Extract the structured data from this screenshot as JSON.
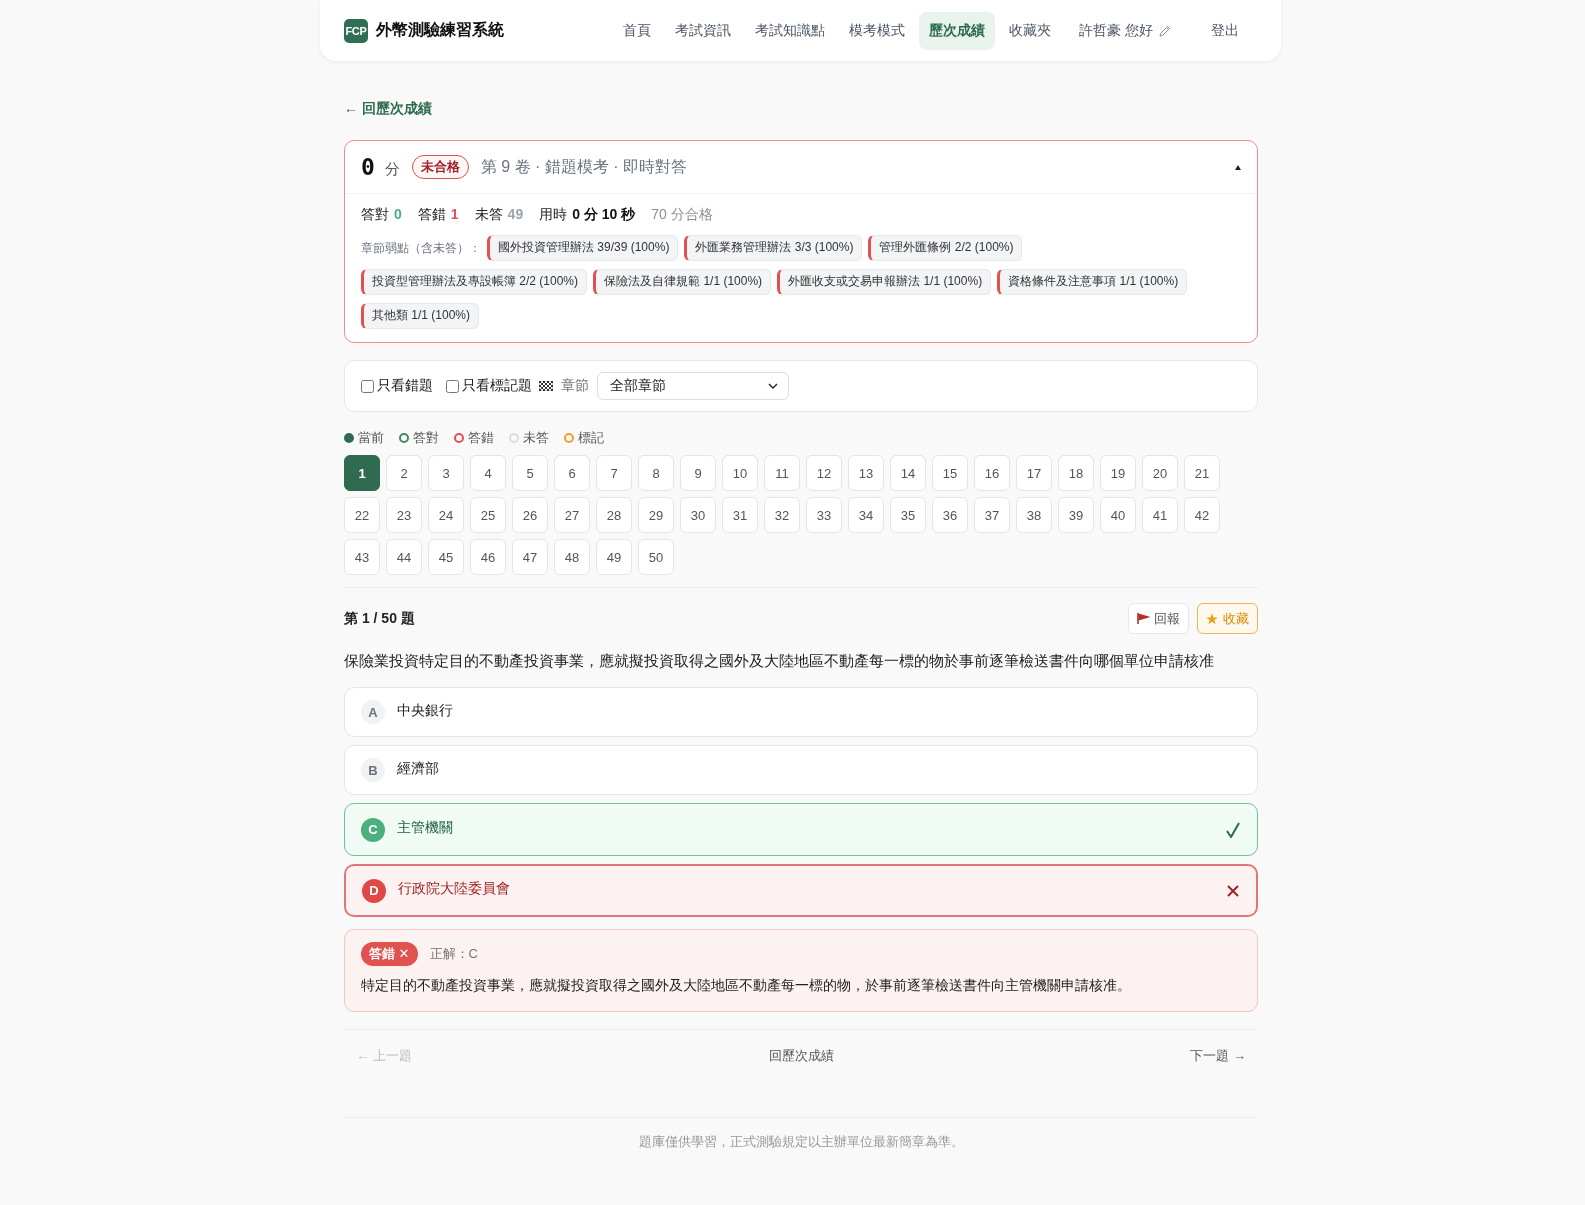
{
  "header": {
    "logo_text": "FCP",
    "title": "外幣測驗練習系統",
    "nav": [
      {
        "label": "首頁",
        "selected": false
      },
      {
        "label": "考試資訊",
        "selected": false
      },
      {
        "label": "考試知識點",
        "selected": false
      },
      {
        "label": "模考模式",
        "selected": false
      },
      {
        "label": "歷次成績",
        "selected": true
      },
      {
        "label": "收藏夾",
        "selected": false
      }
    ],
    "greeting": "許哲豪 您好",
    "logout": "登出"
  },
  "back_link": "← 回歷次成績",
  "score_card": {
    "score": "0",
    "unit": "分",
    "passed": false,
    "badge": "未合格",
    "title": "第 9 卷 · 錯題模考 · 即時對答",
    "expanded": true,
    "stats": [
      {
        "label": "答對",
        "value": "0",
        "kind": "correct"
      },
      {
        "label": "答錯",
        "value": "1",
        "kind": "wrong"
      },
      {
        "label": "未答",
        "value": "49",
        "kind": "unanswered"
      },
      {
        "label": "用時",
        "value": "0 分 10 秒",
        "kind": "time"
      }
    ],
    "pass_mark": "70 分合格",
    "weak_label": "章節弱點（含未答）：",
    "weak_tags": [
      "國外投資管理辦法 39/39 (100%)",
      "外匯業務管理辦法 3/3 (100%)",
      "管理外匯條例 2/2 (100%)",
      "投資型管理辦法及專設帳簿 2/2 (100%)",
      "保險法及自律規範 1/1 (100%)",
      "外匯收支或交易申報辦法 1/1 (100%)",
      "資格條件及注意事項 1/1 (100%)",
      "其他類 1/1 (100%)"
    ]
  },
  "filters": {
    "checkboxes": [
      {
        "label": "只看錯題",
        "checked": false,
        "kind": "plain"
      },
      {
        "label": "只看標記題",
        "checked": false,
        "kind": "flagged"
      }
    ],
    "chapter_label": "章節",
    "chapter_value": "全部章節"
  },
  "legend": [
    {
      "label": "當前",
      "color": "#2e6b50",
      "kind": "filled"
    },
    {
      "label": "答對",
      "color": "#3f8a64",
      "kind": "ring"
    },
    {
      "label": "答錯",
      "color": "#e05252",
      "kind": "ring"
    },
    {
      "label": "未答",
      "color": "#dddddd",
      "kind": "ring"
    },
    {
      "label": "標記",
      "color": "#f0a030",
      "kind": "ring"
    }
  ],
  "question_grid": [
    {
      "number": "1",
      "selected": true
    },
    {
      "number": "2",
      "selected": false
    },
    {
      "number": "3",
      "selected": false
    },
    {
      "number": "4",
      "selected": false
    },
    {
      "number": "5",
      "selected": false
    },
    {
      "number": "6",
      "selected": false
    },
    {
      "number": "7",
      "selected": false
    },
    {
      "number": "8",
      "selected": false
    },
    {
      "number": "9",
      "selected": false
    },
    {
      "number": "10",
      "selected": false
    },
    {
      "number": "11",
      "selected": false
    },
    {
      "number": "12",
      "selected": false
    },
    {
      "number": "13",
      "selected": false
    },
    {
      "number": "14",
      "selected": false
    },
    {
      "number": "15",
      "selected": false
    },
    {
      "number": "16",
      "selected": false
    },
    {
      "number": "17",
      "selected": false
    },
    {
      "number": "18",
      "selected": false
    },
    {
      "number": "19",
      "selected": false
    },
    {
      "number": "20",
      "selected": false
    },
    {
      "number": "21",
      "selected": false
    },
    {
      "number": "22",
      "selected": false
    },
    {
      "number": "23",
      "selected": false
    },
    {
      "number": "24",
      "selected": false
    },
    {
      "number": "25",
      "selected": false
    },
    {
      "number": "26",
      "selected": false
    },
    {
      "number": "27",
      "selected": false
    },
    {
      "number": "28",
      "selected": false
    },
    {
      "number": "29",
      "selected": false
    },
    {
      "number": "30",
      "selected": false
    },
    {
      "number": "31",
      "selected": false
    },
    {
      "number": "32",
      "selected": false
    },
    {
      "number": "33",
      "selected": false
    },
    {
      "number": "34",
      "selected": false
    },
    {
      "number": "35",
      "selected": false
    },
    {
      "number": "36",
      "selected": false
    },
    {
      "number": "37",
      "selected": false
    },
    {
      "number": "38",
      "selected": false
    },
    {
      "number": "39",
      "selected": false
    },
    {
      "number": "40",
      "selected": false
    },
    {
      "number": "41",
      "selected": false
    },
    {
      "number": "42",
      "selected": false
    },
    {
      "number": "43",
      "selected": false
    },
    {
      "number": "44",
      "selected": false
    },
    {
      "number": "45",
      "selected": false
    },
    {
      "number": "46",
      "selected": false
    },
    {
      "number": "47",
      "selected": false
    },
    {
      "number": "48",
      "selected": false
    },
    {
      "number": "49",
      "selected": false
    },
    {
      "number": "50",
      "selected": false
    }
  ],
  "question": {
    "counter": "第 1 / 50 題",
    "actions": [
      {
        "label": "回報",
        "kind": "report"
      },
      {
        "label": "收藏",
        "kind": "favorite"
      }
    ],
    "text": "保險業投資特定目的不動產投資事業，應就擬投資取得之國外及大陸地區不動產每一標的物於事前逐筆檢送書件向哪個單位申請核准",
    "options": [
      {
        "letter": "A",
        "text": "中央銀行",
        "correct": false,
        "selected": false
      },
      {
        "letter": "B",
        "text": "經濟部",
        "correct": false,
        "selected": false
      },
      {
        "letter": "C",
        "text": "主管機關",
        "correct": true,
        "selected": false
      },
      {
        "letter": "D",
        "text": "行政院大陸委員會",
        "correct": false,
        "selected": true
      }
    ]
  },
  "result": {
    "correct": false,
    "verdict": "答錯 ✕",
    "answer": "正解：C",
    "explanation": "特定目的不動產投資事業，應就擬投資取得之國外及大陸地區不動產每一標的物，於事前逐筆檢送書件向主管機關申請核准。"
  },
  "pager": {
    "prev": {
      "label": "← 上一題",
      "disabled": true
    },
    "back": "回歷次成績",
    "next": {
      "label": "下一題 →",
      "disabled": false
    }
  },
  "footer": "題庫僅供學習，正式測驗規定以主辦單位最新簡章為準。"
}
